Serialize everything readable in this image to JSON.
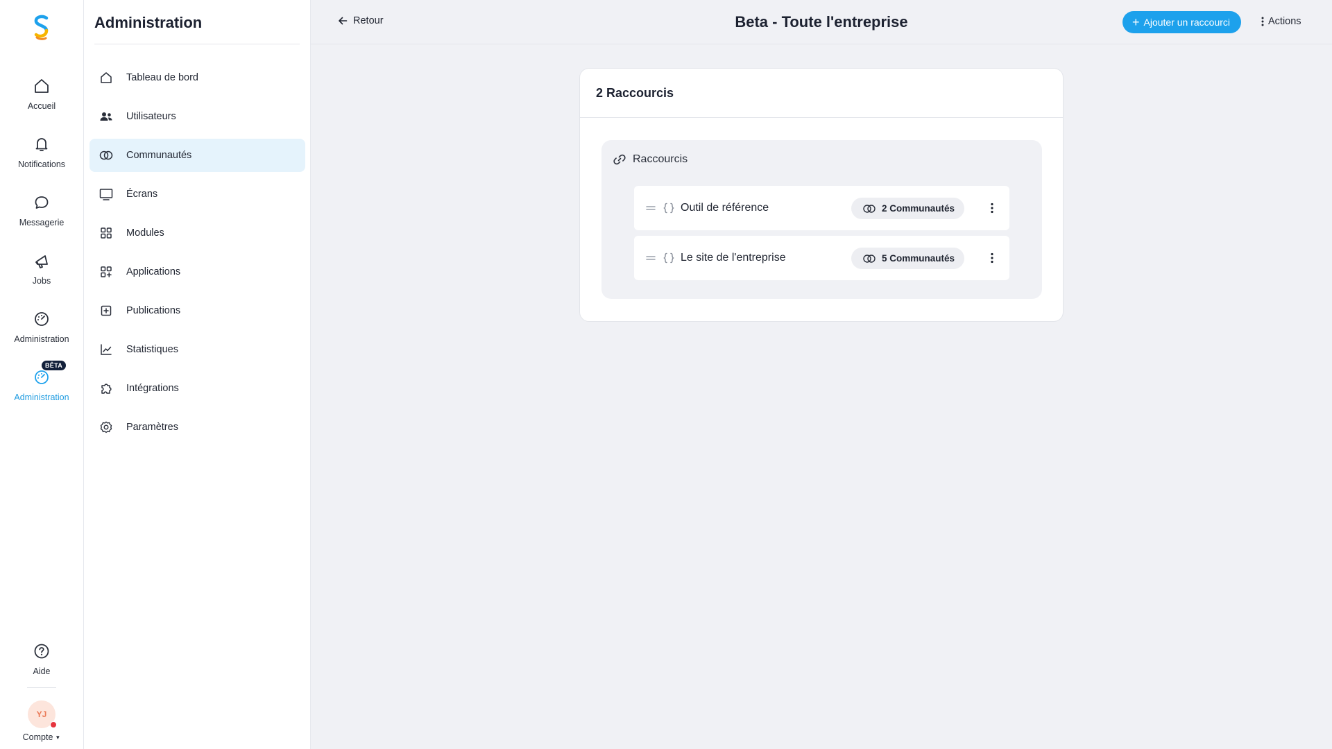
{
  "rail": {
    "items": [
      {
        "label": "Accueil",
        "icon": "home-icon"
      },
      {
        "label": "Notifications",
        "icon": "bell-icon"
      },
      {
        "label": "Messagerie",
        "icon": "chat-bubble-icon"
      },
      {
        "label": "Jobs",
        "icon": "megaphone-icon"
      },
      {
        "label": "Administration",
        "icon": "gauge-icon"
      },
      {
        "label": "Administration",
        "icon": "gauge-icon",
        "badge": "BÊTA",
        "active": true
      }
    ],
    "help_label": "Aide",
    "avatar_initials": "YJ",
    "account_label": "Compte",
    "accent_color": "#1da1ec"
  },
  "sidebar": {
    "title": "Administration",
    "items": [
      {
        "label": "Tableau de bord",
        "icon": "home-icon"
      },
      {
        "label": "Utilisateurs",
        "icon": "users-icon"
      },
      {
        "label": "Communautés",
        "icon": "communities-icon",
        "active": true
      },
      {
        "label": "Écrans",
        "icon": "monitor-icon"
      },
      {
        "label": "Modules",
        "icon": "grid-icon"
      },
      {
        "label": "Applications",
        "icon": "apps-add-icon"
      },
      {
        "label": "Publications",
        "icon": "plus-square-icon"
      },
      {
        "label": "Statistiques",
        "icon": "line-chart-icon"
      },
      {
        "label": "Intégrations",
        "icon": "puzzle-icon"
      },
      {
        "label": "Paramètres",
        "icon": "gear-icon"
      }
    ]
  },
  "header": {
    "back_label": "Retour",
    "title": "Beta - Toute l'entreprise",
    "add_button_label": "Ajouter un raccourci",
    "actions_label": "Actions"
  },
  "main": {
    "card_title": "2 Raccourcis",
    "group_title": "Raccourcis",
    "shortcuts": [
      {
        "name": "Outil de référence",
        "communities": "2 Communautés"
      },
      {
        "name": "Le site de l'entreprise",
        "communities": "5 Communautés"
      }
    ]
  }
}
